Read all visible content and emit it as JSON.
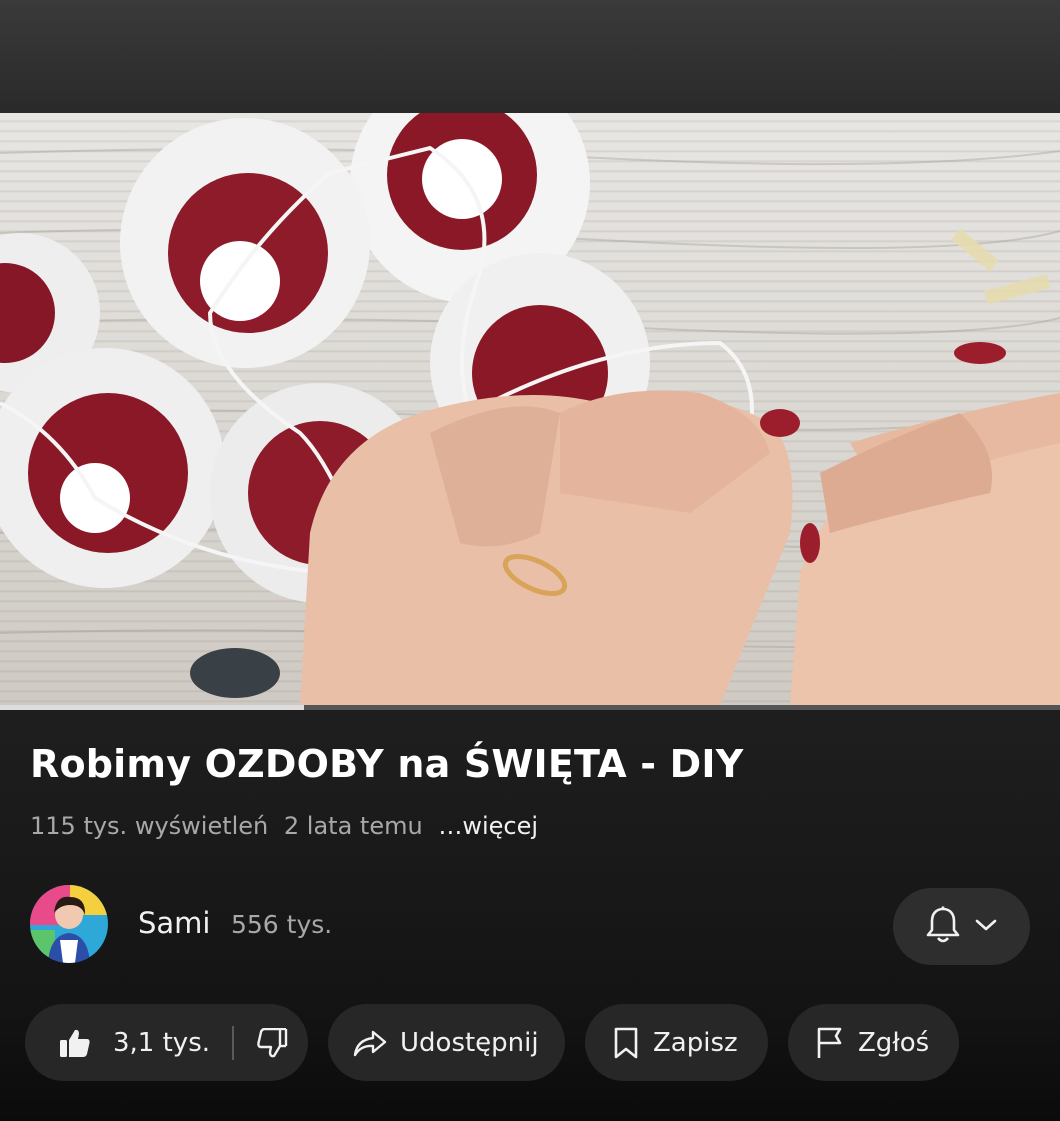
{
  "video": {
    "title": "Robimy OZDOBY na ŚWIĘTA - DIY",
    "progress": 0.287,
    "views": "115 tys. wyświetleń",
    "age": "2 lata temu",
    "more": "…więcej"
  },
  "channel": {
    "name": "Sami",
    "subscribers": "556 tys."
  },
  "actions": {
    "like_count": "3,1 tys.",
    "share_label": "Udostępnij",
    "save_label": "Zapisz",
    "report_label": "Zgłoś"
  },
  "icons": {
    "like": "thumbs-up-icon",
    "dislike": "thumbs-down-icon",
    "share": "share-arrow-icon",
    "save": "bookmark-icon",
    "report": "flag-icon",
    "bell": "bell-icon",
    "chevron": "chevron-down-icon"
  }
}
